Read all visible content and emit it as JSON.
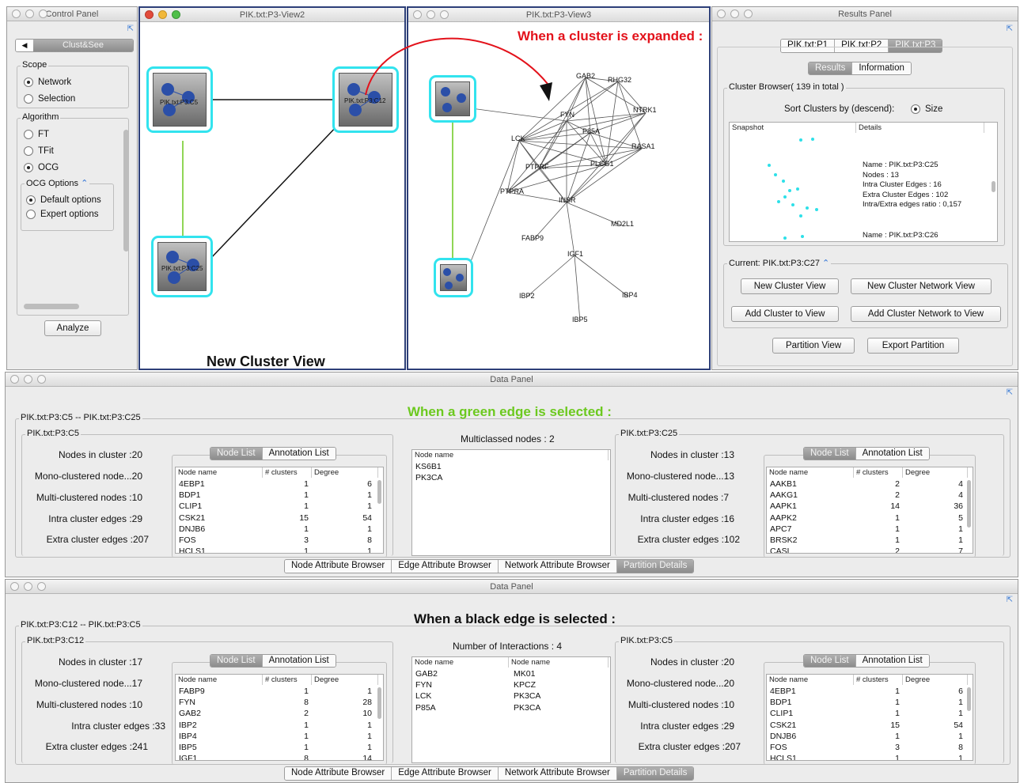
{
  "control_panel": {
    "title": "Control Panel",
    "tab_label": "Clust&See",
    "scope": {
      "legend": "Scope",
      "options": [
        "Network",
        "Selection"
      ],
      "selected": 0
    },
    "algorithm": {
      "legend": "Algorithm",
      "options": [
        "FT",
        "TFit",
        "OCG"
      ],
      "selected": 2
    },
    "ocg_options": {
      "legend": "OCG Options",
      "options": [
        "Default options",
        "Expert options"
      ],
      "selected": 0
    },
    "analyze_button": "Analyze"
  },
  "view2": {
    "title": "PIK.txt:P3-View2",
    "nodes": [
      "PIK.txt:P3:C5",
      "PIK.txt:P3:C12",
      "PIK.txt:P3:C25"
    ],
    "caption": "New Cluster View"
  },
  "view3": {
    "title": "PIK.txt:P3-View3",
    "labels": [
      "GAB2",
      "RHG32",
      "FYN",
      "NTRK1",
      "P85A",
      "LCK",
      "RASA1",
      "PLCG1",
      "PTPRF",
      "PTPRA",
      "INSR",
      "MD2L1",
      "FABP9",
      "IGF1",
      "IBP2",
      "IBP4",
      "IBP5"
    ]
  },
  "annotations": {
    "expanded": "When a cluster is expanded :",
    "green_edge": "When a green edge is selected :",
    "black_edge": "When a black edge is selected :",
    "red": "#e3121b",
    "green": "#6cc91f"
  },
  "results_panel": {
    "title": "Results Panel",
    "tabs": [
      "PIK.txt:P1",
      "PIK.txt:P2",
      "PIK.txt:P3"
    ],
    "active_tab": 2,
    "subtabs": [
      "Results",
      "Information"
    ],
    "cluster_browser": "Cluster Browser( 139 in total )",
    "sort_label": "Sort Clusters by (descend):",
    "sort_option": "Size",
    "columns": [
      "Snapshot",
      "Details"
    ],
    "details": [
      "Name : PIK.txt:P3:C25",
      "Nodes : 13",
      "Intra Cluster Edges : 16",
      "Extra Cluster Edges : 102",
      "Intra/Extra edges ratio : 0,157"
    ],
    "next_name": "Name : PIK.txt:P3:C26",
    "current": "Current: PIK.txt:P3:C27",
    "buttons": [
      "New Cluster View",
      "New Cluster Network View",
      "Add Cluster to View",
      "Add Cluster Network to View",
      "Partition View",
      "Export Partition"
    ]
  },
  "data_panel_1": {
    "title": "Data Panel",
    "pair": "PIK.txt:P3:C5 -- PIK.txt:P3:C25",
    "left": {
      "name": "PIK.txt:P3:C5",
      "stats": [
        "Nodes in cluster :20",
        "Mono-clustered node...20",
        "Multi-clustered nodes :10",
        "Intra cluster edges :29",
        "Extra cluster edges :207"
      ],
      "rows": [
        [
          "4EBP1",
          "1",
          "6"
        ],
        [
          "BDP1",
          "1",
          "1"
        ],
        [
          "CLIP1",
          "1",
          "1"
        ],
        [
          "CSK21",
          "15",
          "54"
        ],
        [
          "DNJB6",
          "1",
          "1"
        ],
        [
          "FOS",
          "3",
          "8"
        ],
        [
          "HCLS1",
          "1",
          "1"
        ]
      ]
    },
    "middle": {
      "title": "Multiclassed nodes : 2",
      "header": [
        "Node name"
      ],
      "rows": [
        [
          "KS6B1"
        ],
        [
          "PK3CA"
        ]
      ]
    },
    "right": {
      "name": "PIK.txt:P3:C25",
      "stats": [
        "Nodes in cluster :13",
        "Mono-clustered node...13",
        "Multi-clustered nodes :7",
        "Intra cluster edges :16",
        "Extra cluster edges :102"
      ],
      "rows": [
        [
          "AAKB1",
          "2",
          "4"
        ],
        [
          "AAKG1",
          "2",
          "4"
        ],
        [
          "AAPK1",
          "14",
          "36"
        ],
        [
          "AAPK2",
          "1",
          "5"
        ],
        [
          "APC7",
          "1",
          "1"
        ],
        [
          "BRSK2",
          "1",
          "1"
        ],
        [
          "CASL",
          "2",
          "7"
        ]
      ]
    }
  },
  "data_panel_2": {
    "title": "Data Panel",
    "pair": "PIK.txt:P3:C12 -- PIK.txt:P3:C5",
    "left": {
      "name": "PIK.txt:P3:C12",
      "stats": [
        "Nodes in cluster :17",
        "Mono-clustered node...17",
        "Multi-clustered nodes :10",
        "Intra cluster edges :33",
        "Extra cluster edges :241"
      ],
      "rows": [
        [
          "FABP9",
          "1",
          "1"
        ],
        [
          "FYN",
          "8",
          "28"
        ],
        [
          "GAB2",
          "2",
          "10"
        ],
        [
          "IBP2",
          "1",
          "1"
        ],
        [
          "IBP4",
          "1",
          "1"
        ],
        [
          "IBP5",
          "1",
          "1"
        ],
        [
          "IGF1",
          "8",
          "14"
        ]
      ]
    },
    "middle": {
      "title": "Number of Interactions : 4",
      "header": [
        "Node name",
        "Node name"
      ],
      "rows": [
        [
          "GAB2",
          "MK01"
        ],
        [
          "FYN",
          "KPCZ"
        ],
        [
          "LCK",
          "PK3CA"
        ],
        [
          "P85A",
          "PK3CA"
        ]
      ]
    },
    "right": {
      "name": "PIK.txt:P3:C5",
      "stats": [
        "Nodes in cluster :20",
        "Mono-clustered node...20",
        "Multi-clustered nodes :10",
        "Intra cluster edges :29",
        "Extra cluster edges :207"
      ],
      "rows": [
        [
          "4EBP1",
          "1",
          "6"
        ],
        [
          "BDP1",
          "1",
          "1"
        ],
        [
          "CLIP1",
          "1",
          "1"
        ],
        [
          "CSK21",
          "15",
          "54"
        ],
        [
          "DNJB6",
          "1",
          "1"
        ],
        [
          "FOS",
          "3",
          "8"
        ],
        [
          "HCLS1",
          "1",
          "1"
        ]
      ]
    }
  },
  "common": {
    "node_list": "Node List",
    "annotation_list": "Annotation List",
    "col_node": "Node name",
    "col_clusters": "# clusters",
    "col_degree": "Degree",
    "bottom_tabs": [
      "Node Attribute Browser",
      "Edge Attribute Browser",
      "Network Attribute Browser",
      "Partition Details"
    ]
  }
}
